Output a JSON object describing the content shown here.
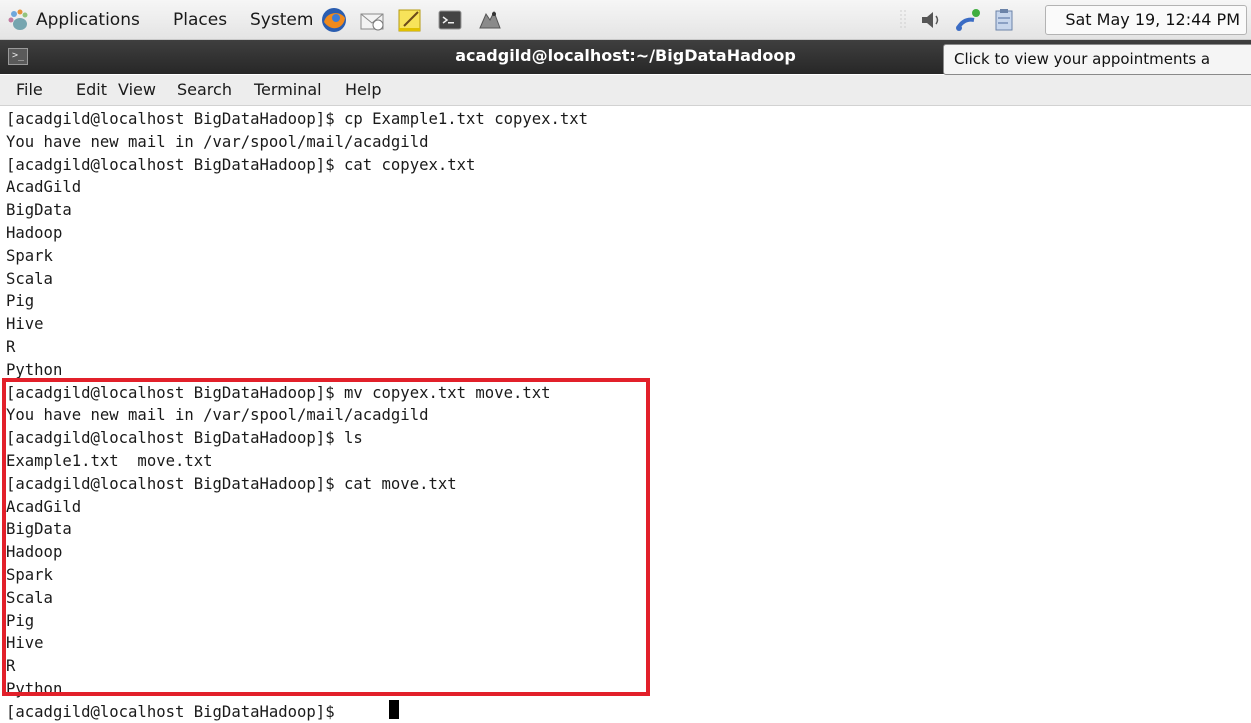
{
  "panel": {
    "menus": [
      "Applications",
      "Places",
      "System"
    ],
    "launchers": [
      "firefox-icon",
      "mail-icon",
      "notes-icon",
      "terminal-icon",
      "screenshot-icon"
    ],
    "tray": [
      "volume-icon",
      "network-icon",
      "clipboard-icon"
    ],
    "clock": "Sat May 19, 12:44 PM"
  },
  "window": {
    "title": "acadgild@localhost:~/BigDataHadoop",
    "tooltip": "Click to view your appointments a"
  },
  "menubar": [
    "File",
    "Edit",
    "View",
    "Search",
    "Terminal",
    "Help"
  ],
  "terminal": {
    "lines": [
      "[acadgild@localhost BigDataHadoop]$ cp Example1.txt copyex.txt",
      "You have new mail in /var/spool/mail/acadgild",
      "[acadgild@localhost BigDataHadoop]$ cat copyex.txt",
      "AcadGild",
      "BigData",
      "Hadoop",
      "Spark",
      "Scala",
      "Pig",
      "Hive",
      "R",
      "Python",
      "[acadgild@localhost BigDataHadoop]$ mv copyex.txt move.txt",
      "You have new mail in /var/spool/mail/acadgild",
      "[acadgild@localhost BigDataHadoop]$ ls",
      "Example1.txt  move.txt",
      "[acadgild@localhost BigDataHadoop]$ cat move.txt",
      "AcadGild",
      "BigData",
      "Hadoop",
      "Spark",
      "Scala",
      "Pig",
      "Hive",
      "R",
      "Python",
      "[acadgild@localhost BigDataHadoop]$ "
    ],
    "highlight_color": "#e2202a"
  }
}
